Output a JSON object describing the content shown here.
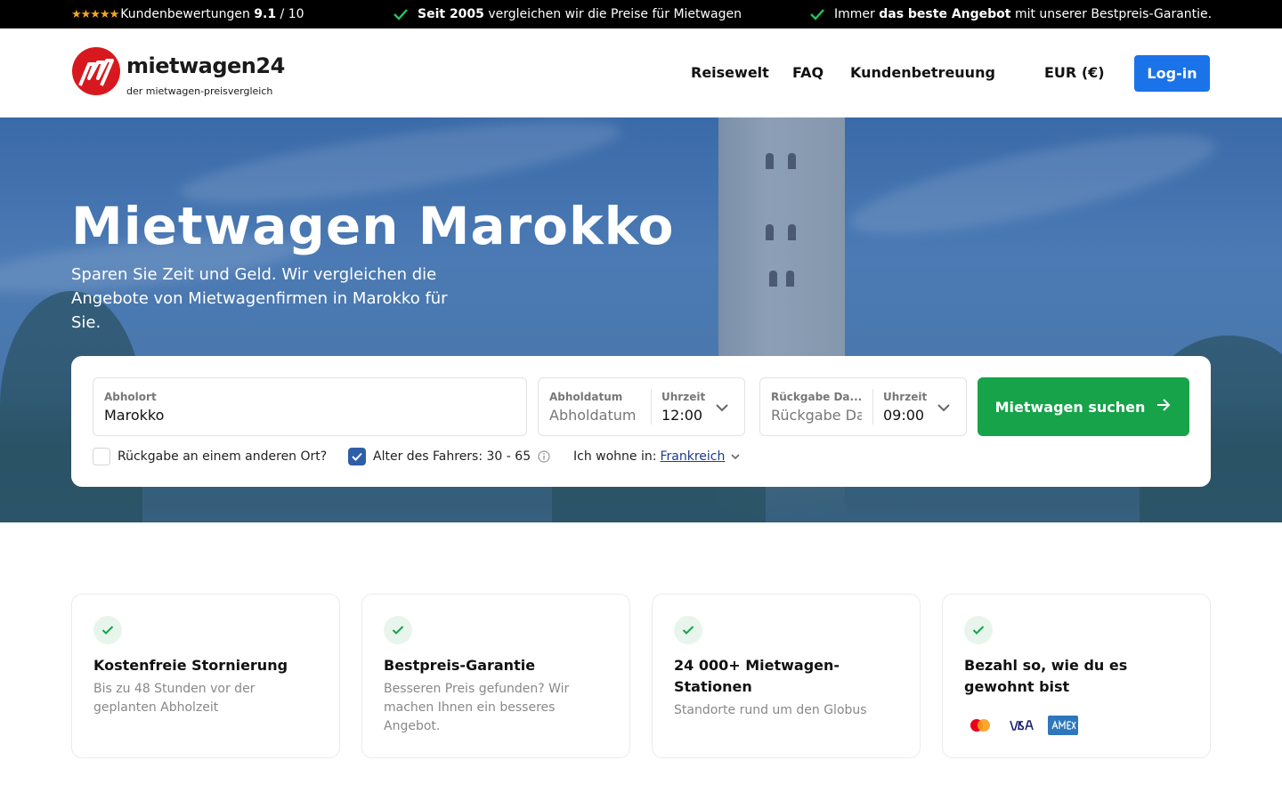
{
  "topbar": {
    "reviews_label": "Kundenbewertungen",
    "reviews_score": "9.1",
    "reviews_scale": "/ 10",
    "item2_bold": "Seit 2005",
    "item2_rest": "vergleichen wir die Preise für Mietwagen",
    "item3_pre": "Immer",
    "item3_bold": "das beste Angebot",
    "item3_rest": "mit unserer Bestpreis-Garantie."
  },
  "header": {
    "logo_name": "mietwagen24",
    "logo_tagline": "der mietwagen-preisvergleich",
    "nav": [
      "Reisewelt",
      "FAQ",
      "Kundenbetreuung"
    ],
    "currency": "EUR (€)",
    "login": "Log-in"
  },
  "hero": {
    "title": "Mietwagen Marokko",
    "subtitle": "Sparen Sie Zeit und Geld. Wir vergleichen die Angebote von Mietwagenfirmen in Marokko für Sie."
  },
  "search": {
    "pickup_label": "Abholort",
    "pickup_value": "Marokko",
    "pickup_date_label": "Abholdatum",
    "pickup_date_placeholder": "Abholdatum",
    "pickup_time_label": "Uhrzeit",
    "pickup_time": "12:00",
    "return_date_label": "Rückgabe Da...",
    "return_date_placeholder": "Rückgabe Da",
    "return_time_label": "Uhrzeit",
    "return_time": "09:00",
    "submit": "Mietwagen suchen",
    "other_return": "Rückgabe an einem anderen Ort?",
    "driver_age": "Alter des Fahrers: 30 - 65",
    "residence_label": "Ich wohne in:",
    "residence_value": "Frankreich"
  },
  "features": [
    {
      "title": "Kostenfreie Stornierung",
      "desc": "Bis zu 48 Stunden vor der geplanten Abholzeit"
    },
    {
      "title": "Bestpreis-Garantie",
      "desc": "Besseren Preis gefunden? Wir machen Ihnen ein besseres Angebot."
    },
    {
      "title": "24 000+ Mietwagen-Stationen",
      "desc": "Standorte rund um den Globus"
    },
    {
      "title": "Bezahl so, wie du es gewohnt bist",
      "payment": [
        "mastercard-icon",
        "visa-icon",
        "amex-icon"
      ]
    }
  ],
  "colors": {
    "login_blue": "#1a73e8",
    "search_green": "#16a34a",
    "checkbox_blue": "#2f5ea8",
    "brand_red": "#d7191f"
  }
}
